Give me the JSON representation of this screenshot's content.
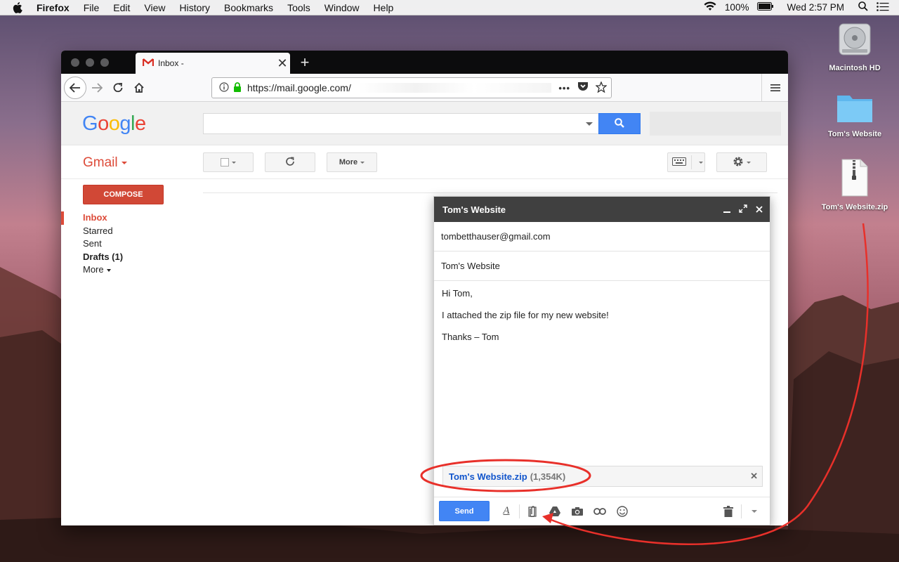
{
  "menubar": {
    "app": "Firefox",
    "items": [
      "File",
      "Edit",
      "View",
      "History",
      "Bookmarks",
      "Tools",
      "Window",
      "Help"
    ],
    "battery": "100%",
    "clock": "Wed 2:57 PM"
  },
  "desktop": {
    "icons": [
      {
        "label": "Macintosh HD",
        "icon": "hard-drive-icon"
      },
      {
        "label": "Tom's Website",
        "icon": "folder-icon"
      },
      {
        "label": "Tom's Website.zip",
        "icon": "zip-file-icon",
        "badge": "ZIP"
      }
    ]
  },
  "browser": {
    "tab_title": "Inbox -",
    "url": "https://mail.google.com/"
  },
  "gmail": {
    "logo": [
      "G",
      "o",
      "o",
      "g",
      "l",
      "e"
    ],
    "logo_colors": [
      "#4285f4",
      "#ea4335",
      "#fbbc05",
      "#4285f4",
      "#34a853",
      "#ea4335"
    ],
    "product": "Gmail",
    "more_button": "More",
    "compose_button": "COMPOSE",
    "nav": [
      {
        "label": "Inbox",
        "state": "active"
      },
      {
        "label": "Starred",
        "state": "normal"
      },
      {
        "label": "Sent",
        "state": "normal"
      },
      {
        "label": "Drafts (1)",
        "state": "bold"
      },
      {
        "label": "More",
        "state": "normal"
      }
    ]
  },
  "compose": {
    "title": "Tom's Website",
    "to": "tombetthauser@gmail.com",
    "subject": "Tom's Website",
    "body": [
      "Hi Tom,",
      "I attached the zip file for my new website!",
      "Thanks – Tom"
    ],
    "attachment_name": "Tom's Website.zip",
    "attachment_size": "(1,354K)",
    "send_button": "Send"
  },
  "colors": {
    "gmail_red": "#dd4b39",
    "google_blue": "#4285f4",
    "annotation_red": "#e8302a"
  }
}
